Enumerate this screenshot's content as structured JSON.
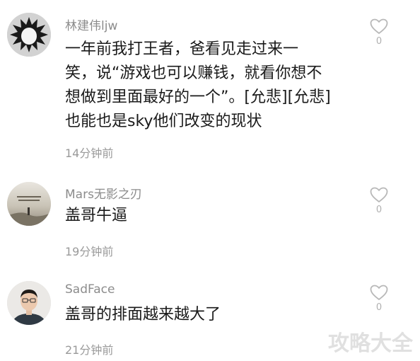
{
  "comments": [
    {
      "username": "林建伟ljw",
      "lines": [
        "一年前我打王者，爸看见走过来一",
        "笑，说“游戏也可以赚钱，就看你想不",
        "想做到里面最好的一个”。[允悲][允悲]",
        "也能也是sky他们改变的现状"
      ],
      "time": "14分钟前",
      "likes": "0",
      "avatar_icon": "spiky-burst-avatar"
    },
    {
      "username": "Mars无影之刃",
      "lines": [
        "盖哥牛逼"
      ],
      "time": "19分钟前",
      "likes": "0",
      "avatar_icon": "landscape-avatar"
    },
    {
      "username": "SadFace",
      "lines": [
        "盖哥的排面越来越大了"
      ],
      "time": "21分钟前",
      "likes": "0",
      "avatar_icon": "portrait-avatar"
    }
  ],
  "watermark": "攻略大全",
  "colors": {
    "username": "#8c8c8c",
    "text": "#1a1a1a",
    "time": "#9a9a9a",
    "like": "#b8b8b8"
  }
}
